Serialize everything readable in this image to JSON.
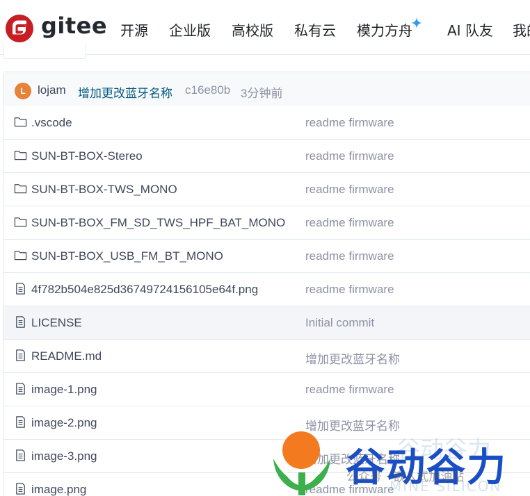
{
  "header": {
    "logo_text": "gitee",
    "nav": [
      {
        "label": "开源"
      },
      {
        "label": "企业版"
      },
      {
        "label": "高校版"
      },
      {
        "label": "私有云"
      },
      {
        "label": "模力方舟"
      },
      {
        "label": "AI 队友"
      },
      {
        "label": "我的"
      }
    ]
  },
  "commit": {
    "avatar_letter": "L",
    "author": "lojam",
    "message": "增加更改蓝牙名称",
    "hash": "c16e80b",
    "time": "3分钟前"
  },
  "files": [
    {
      "type": "folder",
      "name": ".vscode",
      "commit": "readme firmware"
    },
    {
      "type": "folder",
      "name": "SUN-BT-BOX-Stereo",
      "commit": "readme firmware"
    },
    {
      "type": "folder",
      "name": "SUN-BT-BOX-TWS_MONO",
      "commit": "readme firmware"
    },
    {
      "type": "folder",
      "name": "SUN-BT-BOX_FM_SD_TWS_HPF_BAT_MONO",
      "commit": "readme firmware"
    },
    {
      "type": "folder",
      "name": "SUN-BT-BOX_USB_FM_BT_MONO",
      "commit": "readme firmware"
    },
    {
      "type": "file",
      "name": "4f782b504e825d36749724156105e64f.png",
      "commit": "readme firmware"
    },
    {
      "type": "file",
      "name": "LICENSE",
      "commit": "Initial commit"
    },
    {
      "type": "file",
      "name": "README.md",
      "commit": "增加更改蓝牙名称"
    },
    {
      "type": "file",
      "name": "image-1.png",
      "commit": "readme firmware"
    },
    {
      "type": "file",
      "name": "image-2.png",
      "commit": "增加更改蓝牙名称"
    },
    {
      "type": "file",
      "name": "image-3.png",
      "commit": "增加更改蓝牙名称"
    },
    {
      "type": "file",
      "name": "image.png",
      "commit": "readme firmware"
    }
  ],
  "watermark": {
    "brand": "谷动谷力",
    "ghost": "谷动谷力",
    "subtitle": "公众号 · 嵌入式加油站",
    "subtitle_2": "MINE SILICON"
  },
  "colors": {
    "logo_red": "#c71d23",
    "link": "#005980",
    "muted": "#8c92a4",
    "avatar": "#e7823a",
    "sparkle": "#2f9bf5",
    "watermark_orange": "#f47a20",
    "watermark_green": "#3db04b",
    "watermark_blue": "#1a4ec4"
  }
}
